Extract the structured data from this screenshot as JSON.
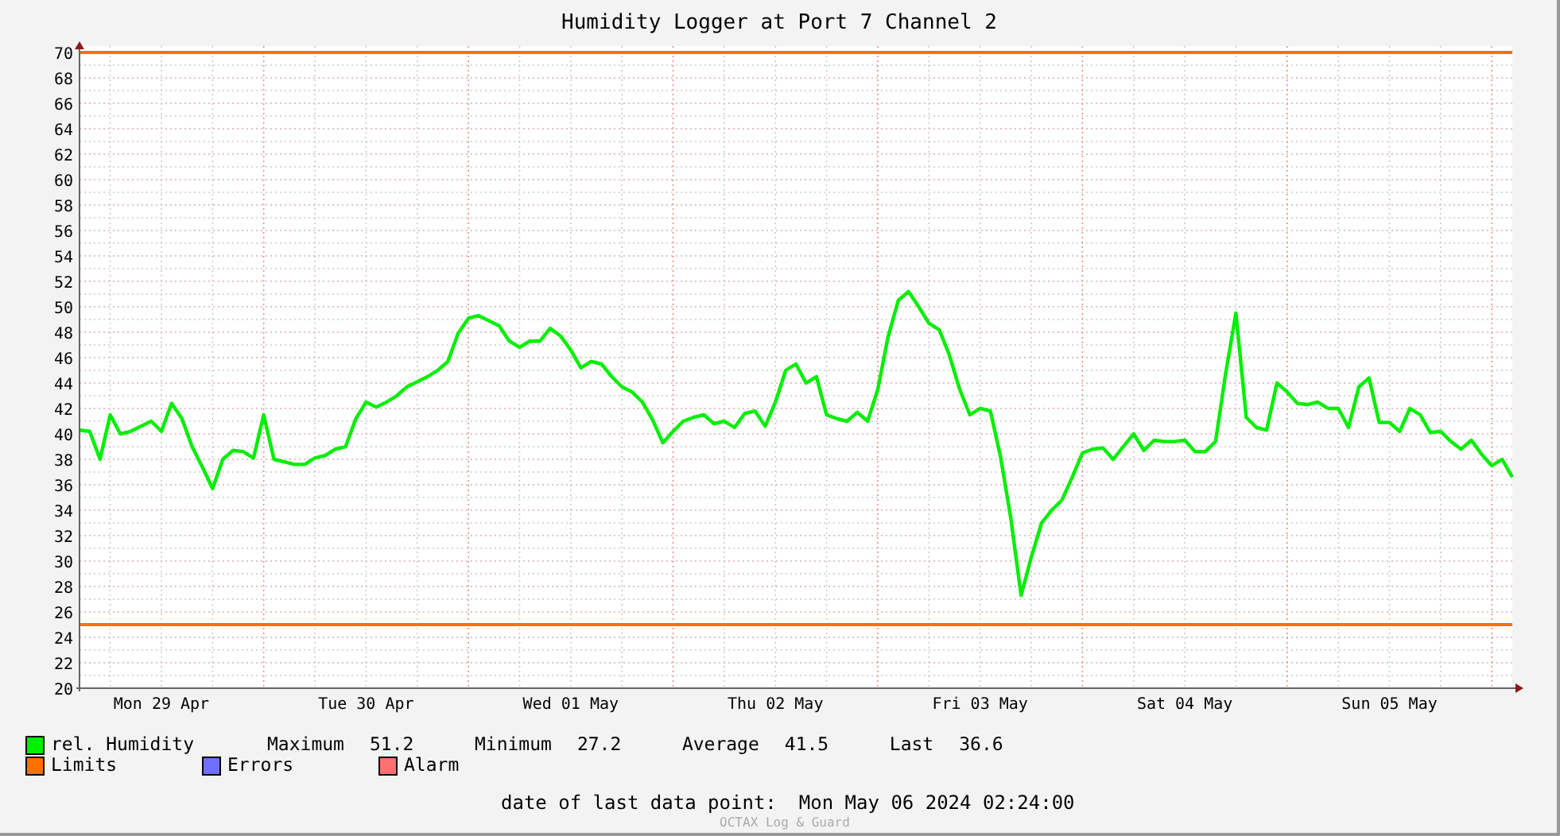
{
  "graph": {
    "chart_data": {
      "type": "line",
      "title": "Humidity Logger at Port 7 Channel 2",
      "categories": [
        null,
        null,
        null,
        null,
        null,
        null,
        null,
        null,
        "Mon 29 Apr",
        null,
        null,
        null,
        null,
        null,
        null,
        null,
        null,
        null,
        null,
        null,
        null,
        null,
        null,
        null,
        null,
        null,
        null,
        null,
        "Tue 30 Apr",
        null,
        null,
        null,
        null,
        null,
        null,
        null,
        null,
        null,
        null,
        null,
        null,
        null,
        null,
        null,
        null,
        null,
        null,
        null,
        "Wed 01 May",
        null,
        null,
        null,
        null,
        null,
        null,
        null,
        null,
        null,
        null,
        null,
        null,
        null,
        null,
        null,
        null,
        null,
        null,
        null,
        "Thu 02 May",
        null,
        null,
        null,
        null,
        null,
        null,
        null,
        null,
        null,
        null,
        null,
        null,
        null,
        null,
        null,
        null,
        null,
        null,
        null,
        "Fri 03 May",
        null,
        null,
        null,
        null,
        null,
        null,
        null,
        null,
        null,
        null,
        null,
        null,
        null,
        null,
        null,
        null,
        null,
        null,
        null,
        "Sat 04 May",
        null,
        null,
        null,
        null,
        null,
        null,
        null,
        null,
        null,
        null,
        null,
        null,
        null,
        null,
        null,
        null,
        null,
        null,
        null,
        "Sun 05 May",
        null,
        null,
        null,
        null,
        null,
        null,
        null,
        null,
        null,
        null,
        null,
        null
      ],
      "series": [
        {
          "name": "rel. Humidity",
          "color": "#00ee00",
          "values": [
            40.3,
            40.2,
            38,
            41.5,
            40,
            40.2,
            40.6,
            41,
            40.2,
            42.4,
            41.2,
            39,
            37.4,
            35.7,
            38,
            38.7,
            38.6,
            38.1,
            41.5,
            38,
            37.8,
            37.6,
            37.6,
            38.1,
            38.3,
            38.8,
            39,
            41.2,
            42.5,
            42.1,
            42.5,
            43,
            43.7,
            44.1,
            44.5,
            45,
            45.7,
            47.9,
            49.1,
            49.3,
            48.9,
            48.5,
            47.3,
            46.8,
            47.3,
            47.3,
            48.3,
            47.7,
            46.6,
            45.2,
            45.7,
            45.5,
            44.5,
            43.7,
            43.3,
            42.5,
            41.1,
            39.3,
            40.2,
            41,
            41.3,
            41.5,
            40.8,
            41,
            40.5,
            41.6,
            41.8,
            40.6,
            42.5,
            45,
            45.5,
            44,
            44.5,
            41.5,
            41.2,
            41,
            41.7,
            41,
            43.5,
            47.6,
            50.5,
            51.2,
            50,
            48.7,
            48.2,
            46.2,
            43.5,
            41.5,
            42,
            41.8,
            38.2,
            33.4,
            27.3,
            30.3,
            33,
            34,
            34.8,
            36.6,
            38.5,
            38.8,
            38.9,
            38,
            39,
            40,
            38.7,
            39.5,
            39.4,
            39.4,
            39.5,
            38.6,
            38.6,
            39.4,
            44.8,
            49.5,
            41.3,
            40.5,
            40.3,
            44,
            43.3,
            42.4,
            42.3,
            42.5,
            42,
            42,
            40.5,
            43.7,
            44.4,
            40.9,
            40.9,
            40.2,
            42,
            41.5,
            40.1,
            40.2,
            39.4,
            38.8,
            39.5,
            38.4,
            37.5,
            38,
            36.6
          ]
        }
      ],
      "ylim": [
        20,
        70
      ],
      "yticks": [
        20,
        22,
        24,
        26,
        28,
        30,
        32,
        34,
        36,
        38,
        40,
        42,
        44,
        46,
        48,
        50,
        52,
        54,
        56,
        58,
        60,
        62,
        64,
        66,
        68,
        70
      ],
      "grid": true,
      "ref_lines": [
        {
          "axis": "y",
          "value": 70
        },
        {
          "axis": "y",
          "value": 25
        }
      ]
    }
  },
  "legend": [
    {
      "kind": "series",
      "stats": [
        {
          "label": "Maximum",
          "value": "51.2"
        },
        {
          "label": "Minimum",
          "value": "27.2"
        },
        {
          "label": "Average",
          "value": "41.5"
        },
        {
          "label": "Last",
          "value": "36.6"
        }
      ]
    },
    {
      "kind": "limit",
      "label": "Limits",
      "color": "#ff7000"
    },
    {
      "kind": "flag",
      "label": "Errors",
      "color": "#7070ff"
    },
    {
      "kind": "flag",
      "label": "Alarm",
      "color": "#ff7070"
    }
  ],
  "last_data_point": {
    "label": "date of last data point:",
    "value": "Mon May 06 2024 02:24:00"
  },
  "credit": "OCTAX Log & Guard"
}
